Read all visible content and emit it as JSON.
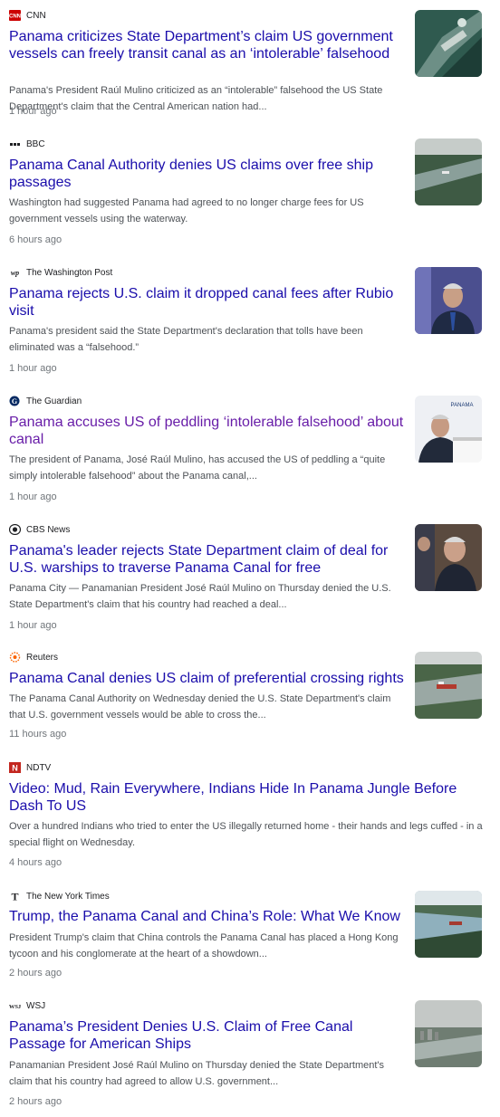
{
  "articles": [
    {
      "source": "CNN",
      "logo": "cnn-logo",
      "title": "Panama criticizes State Department’s claim US government vessels can freely transit canal as an ‘intolerable’ falsehood",
      "snippet": "Panama's President Raúl Mulino criticized as an “intolerable” falsehood the US State Department's claim that the Central American nation had...",
      "time": "1 hour ago",
      "visited": false,
      "image": "canal-locks-aerial"
    },
    {
      "source": "BBC",
      "logo": "bbc-logo",
      "title": "Panama Canal Authority denies US claims over free ship passages",
      "snippet": "Washington had suggested Panama had agreed to no longer charge fees for US government vessels using the waterway.",
      "time": "6 hours ago",
      "visited": false,
      "image": "canal-river-aerial"
    },
    {
      "source": "The Washington Post",
      "logo": "wapo-logo",
      "title": "Panama rejects U.S. claim it dropped canal fees after Rubio visit",
      "snippet": "Panama's president said the State Department's declaration that tolls have been eliminated was a “falsehood.”",
      "time": "1 hour ago",
      "visited": false,
      "image": "president-portrait"
    },
    {
      "source": "The Guardian",
      "logo": "guardian-logo",
      "title": "Panama accuses US of peddling ‘intolerable falsehood’ about canal",
      "snippet": "The president of Panama, José Raúl Mulino, has accused the US of peddling a “quite simply intolerable falsehood” about the Panama canal,...",
      "time": "1 hour ago",
      "visited": true,
      "image": "president-podium",
      "image_text": "PANAMA"
    },
    {
      "source": "CBS News",
      "logo": "cbs-logo",
      "title": "Panama's leader rejects State Department claim of deal for U.S. warships to traverse Panama Canal for free",
      "snippet": "Panama City — Panamanian President José Raúl Mulino on Thursday denied the U.S. State Department's claim that his country had reached a deal...",
      "time": "1 hour ago",
      "visited": false,
      "image": "president-briefing"
    },
    {
      "source": "Reuters",
      "logo": "reuters-logo",
      "title": "Panama Canal denies US claim of preferential crossing rights",
      "snippet": "The Panama Canal Authority on Wednesday denied the U.S. State Department's claim that U.S. government vessels would be able to cross the...",
      "time": "11 hours ago",
      "visited": false,
      "image": "ship-in-canal"
    },
    {
      "source": "NDTV",
      "logo": "ndtv-logo",
      "title": "Video: Mud, Rain Everywhere, Indians Hide In Panama Jungle Before Dash To US",
      "snippet": "Over a hundred Indians who tried to enter the US illegally returned home - their hands and legs cuffed - in a special flight on Wednesday.",
      "time": "4 hours ago",
      "visited": false,
      "image": ""
    },
    {
      "source": "The New York Times",
      "logo": "nyt-logo",
      "title": "Trump, the Panama Canal and China’s Role: What We Know",
      "snippet": "President Trump's claim that China controls the Panama Canal has placed a Hong Kong tycoon and his conglomerate at the heart of a showdown...",
      "time": "2 hours ago",
      "visited": false,
      "image": "canal-ships-aerial"
    },
    {
      "source": "WSJ",
      "logo": "wsj-logo",
      "title": "Panama’s President Denies U.S. Claim of Free Canal Passage for American Ships",
      "snippet": "Panamanian President José Raúl Mulino on Thursday denied the State Department's claim that his country had agreed to allow U.S. government...",
      "time": "2 hours ago",
      "visited": false,
      "image": "city-port-aerial"
    }
  ],
  "colors": {
    "link": "#1a0dab",
    "visited": "#681da8",
    "snippet": "#4d5156",
    "time": "#70757a"
  }
}
